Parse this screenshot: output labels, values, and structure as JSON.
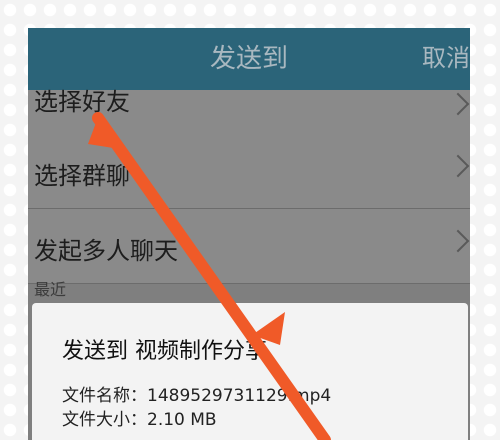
{
  "header": {
    "title": "发送到",
    "cancel_label": "取消"
  },
  "rows": [
    {
      "label": "选择好友"
    },
    {
      "label": "选择群聊"
    },
    {
      "label": "发起多人聊天"
    }
  ],
  "recent_label": "最近",
  "dialog": {
    "title": "发送到 视频制作分享",
    "file_name_line": "文件名称：1489529731129.mp4",
    "file_size_line": "文件大小：2.10 MB"
  },
  "colors": {
    "accent_bar": "#2b6479",
    "arrow": "#f05a28"
  }
}
